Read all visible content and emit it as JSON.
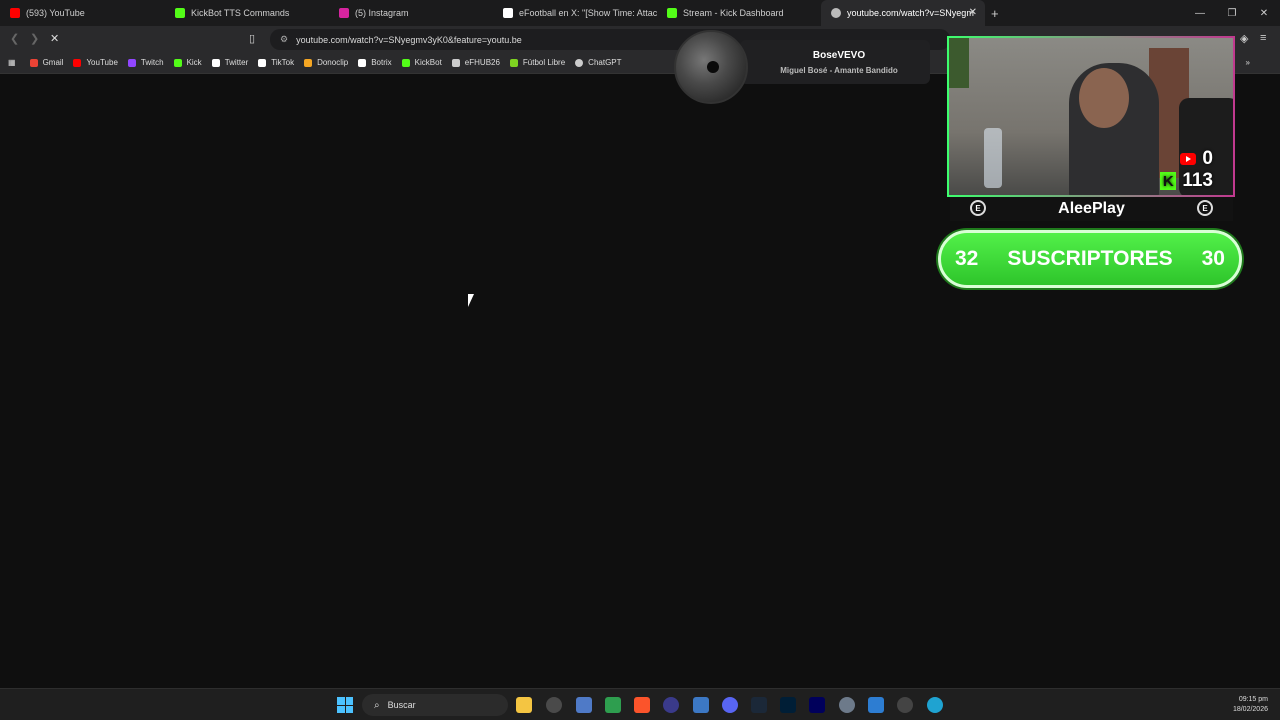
{
  "tabs": [
    {
      "title": "(593) YouTube",
      "favicon_color": "#ff0000"
    },
    {
      "title": "KickBot TTS Commands",
      "favicon_color": "#53fc18"
    },
    {
      "title": "(5) Instagram",
      "favicon_color": "#d6249f"
    },
    {
      "title": "eFootball en X: \"[Show Time: Attack",
      "favicon_color": "#ffffff"
    },
    {
      "title": "Stream - Kick Dashboard",
      "favicon_color": "#53fc18"
    },
    {
      "title": "youtube.com/watch?v=SNyegm",
      "favicon_color": "#bbbbbb",
      "active": true
    }
  ],
  "address_bar": {
    "url": "youtube.com/watch?v=SNyegmv3yK0&feature=youtu.be"
  },
  "bookmarks": [
    {
      "label": "Gmail",
      "color": "#ea4335"
    },
    {
      "label": "YouTube",
      "color": "#ff0000"
    },
    {
      "label": "Twitch",
      "color": "#9146ff"
    },
    {
      "label": "Kick",
      "color": "#53fc18"
    },
    {
      "label": "Twitter",
      "color": "#ffffff"
    },
    {
      "label": "TikTok",
      "color": "#ffffff"
    },
    {
      "label": "Donoclip",
      "color": "#f5a623"
    },
    {
      "label": "Botrix",
      "color": "#ffffff"
    },
    {
      "label": "KickBot",
      "color": "#53fc18"
    },
    {
      "label": "eFHUB26",
      "color": "#cccccc"
    },
    {
      "label": "Fútbol Libre",
      "color": "#7ed321"
    },
    {
      "label": "ChatGPT",
      "color": "#cccccc"
    }
  ],
  "now_playing": {
    "artist": "BoseVEVO",
    "track": "Miguel Bosé - Amante Bandido"
  },
  "webcam": {
    "youtube_count": "0",
    "kick_count": "113",
    "streamer_name": "AleePlay",
    "badge": "E"
  },
  "subscribers": {
    "left": "32",
    "label": "SUSCRIPTORES",
    "right": "30"
  },
  "taskbar": {
    "search_placeholder": "Buscar",
    "time": "09:15 pm",
    "date": "18/02/2026"
  }
}
